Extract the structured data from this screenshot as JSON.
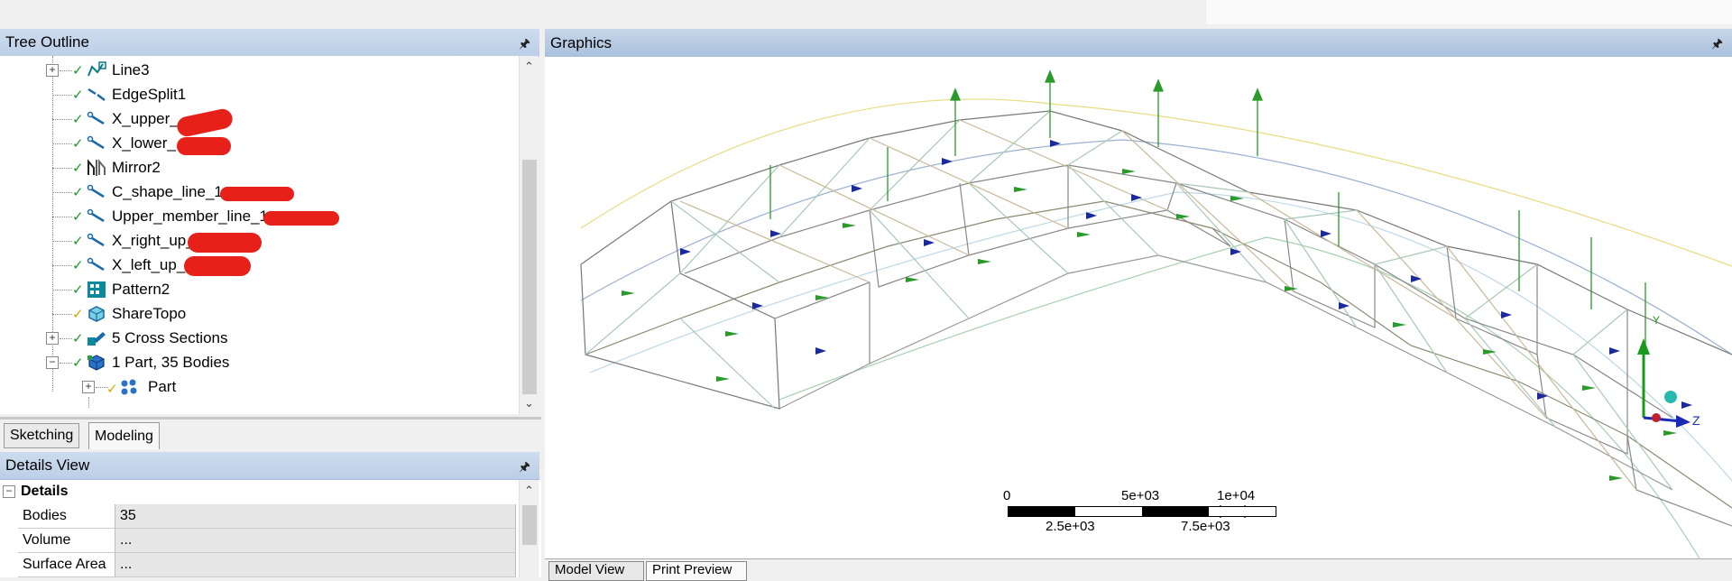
{
  "tree_outline": {
    "title": "Tree Outline",
    "items": [
      {
        "label": "Line3",
        "icon": "line-sketch-icon",
        "expandable": true
      },
      {
        "label": "EdgeSplit1",
        "icon": "edge-split-icon",
        "expandable": false
      },
      {
        "label": "X_upper_",
        "icon": "line-body-icon",
        "expandable": false
      },
      {
        "label": "X_lower_",
        "icon": "line-body-icon",
        "expandable": false
      },
      {
        "label": "Mirror2",
        "icon": "mirror-icon",
        "expandable": false
      },
      {
        "label": "C_shape_line_1",
        "icon": "line-body-icon",
        "expandable": false
      },
      {
        "label": "Upper_member_line_1",
        "icon": "line-body-icon",
        "expandable": false
      },
      {
        "label": "X_right_up_",
        "icon": "line-body-icon",
        "expandable": false
      },
      {
        "label": "X_left_up_",
        "icon": "line-body-icon",
        "expandable": false
      },
      {
        "label": "Pattern2",
        "icon": "pattern-icon",
        "expandable": false
      },
      {
        "label": "ShareTopo",
        "icon": "share-topology-icon",
        "expandable": false
      },
      {
        "label": "5 Cross Sections",
        "icon": "cross-sections-icon",
        "expandable": true
      },
      {
        "label": "1 Part, 35 Bodies",
        "icon": "part-bodies-icon",
        "expandable": true,
        "expanded": true
      },
      {
        "label": "Part",
        "icon": "part-icon",
        "expandable": true
      }
    ]
  },
  "tabs": {
    "sketching": "Sketching",
    "modeling": "Modeling"
  },
  "details_view": {
    "title": "Details View",
    "section": "Details",
    "rows": [
      {
        "name": "Bodies",
        "value": "35"
      },
      {
        "name": "Volume",
        "value": "..."
      },
      {
        "name": "Surface Area",
        "value": "..."
      }
    ]
  },
  "graphics": {
    "title": "Graphics",
    "scale": {
      "top_labels": [
        "0",
        "5e+03",
        "1e+04 (mm)"
      ],
      "bottom_labels": [
        "2.5e+03",
        "7.5e+03"
      ]
    },
    "bottom_tabs": [
      "Model View",
      "Print Preview"
    ]
  },
  "colors": {
    "header_blue": "#bccfe7",
    "check_green": "#1a9a2a",
    "redaction_red": "#e8201a"
  }
}
